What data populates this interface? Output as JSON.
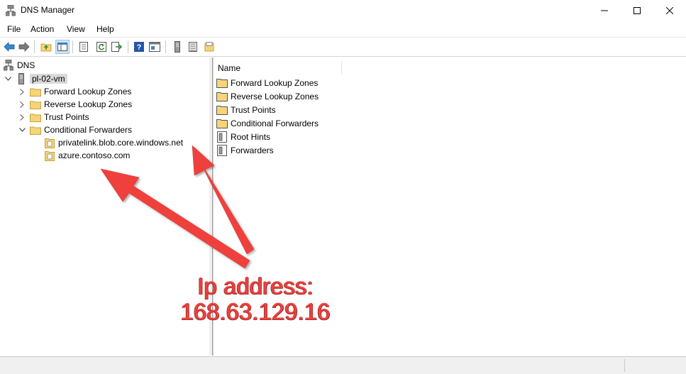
{
  "window": {
    "title": "DNS Manager"
  },
  "menu": [
    "File",
    "Action",
    "View",
    "Help"
  ],
  "toolbar": {
    "icons": [
      "back-icon",
      "forward-icon",
      "up-folder-icon",
      "show-hide-tree-icon",
      "properties-icon",
      "refresh-icon",
      "export-list-icon",
      "help-icon",
      "console-icon",
      "server-icon",
      "list-icon",
      "folder-icon"
    ]
  },
  "tree": {
    "root": "DNS",
    "server": "pl-02-vm",
    "items": [
      "Forward Lookup Zones",
      "Reverse Lookup Zones",
      "Trust Points",
      "Conditional Forwarders"
    ],
    "forwarders": [
      "privatelink.blob.core.windows.net",
      "azure.contoso.com"
    ]
  },
  "list": {
    "column": "Name",
    "items": [
      "Forward Lookup Zones",
      "Reverse Lookup Zones",
      "Trust Points",
      "Conditional Forwarders",
      "Root Hints",
      "Forwarders"
    ]
  },
  "annotation": {
    "line1": "Ip address:",
    "line2": "168.63.129.16",
    "color": "#f0413e"
  },
  "colors": {
    "folder": "#f5d47a",
    "folder_border": "#c9a23a",
    "selection": "#d9d9d9",
    "accent": "#3a86d1"
  }
}
